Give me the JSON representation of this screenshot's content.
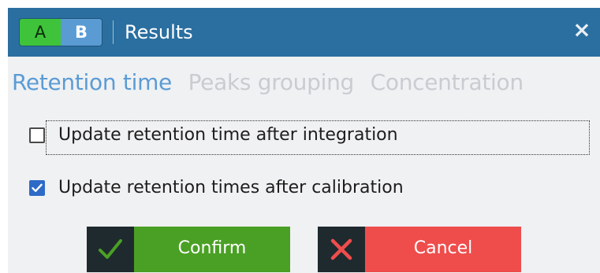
{
  "window": {
    "title": "Results",
    "close_glyph": "×",
    "ab_toggle": {
      "a_label": "A",
      "b_label": "B",
      "a_color": "#3ec33a",
      "b_color": "#5a9bd4"
    }
  },
  "tabs": [
    {
      "label": "Retention time",
      "active": true
    },
    {
      "label": "Peaks grouping",
      "active": false
    },
    {
      "label": "Concentration",
      "active": false
    }
  ],
  "options": [
    {
      "label": "Update retention time after integration",
      "checked": false
    },
    {
      "label": "Update retention times after calibration",
      "checked": true
    }
  ],
  "buttons": {
    "confirm": {
      "label": "Confirm",
      "icon": "checkmark-icon",
      "color": "#4aa024"
    },
    "cancel": {
      "label": "Cancel",
      "icon": "x-icon",
      "color": "#ee4d4c"
    }
  },
  "colors": {
    "titlebar": "#2a6fa0",
    "active_tab": "#5b9bd5",
    "inactive_tab": "#c9ccd0",
    "checkbox_checked": "#2e6bc7"
  }
}
